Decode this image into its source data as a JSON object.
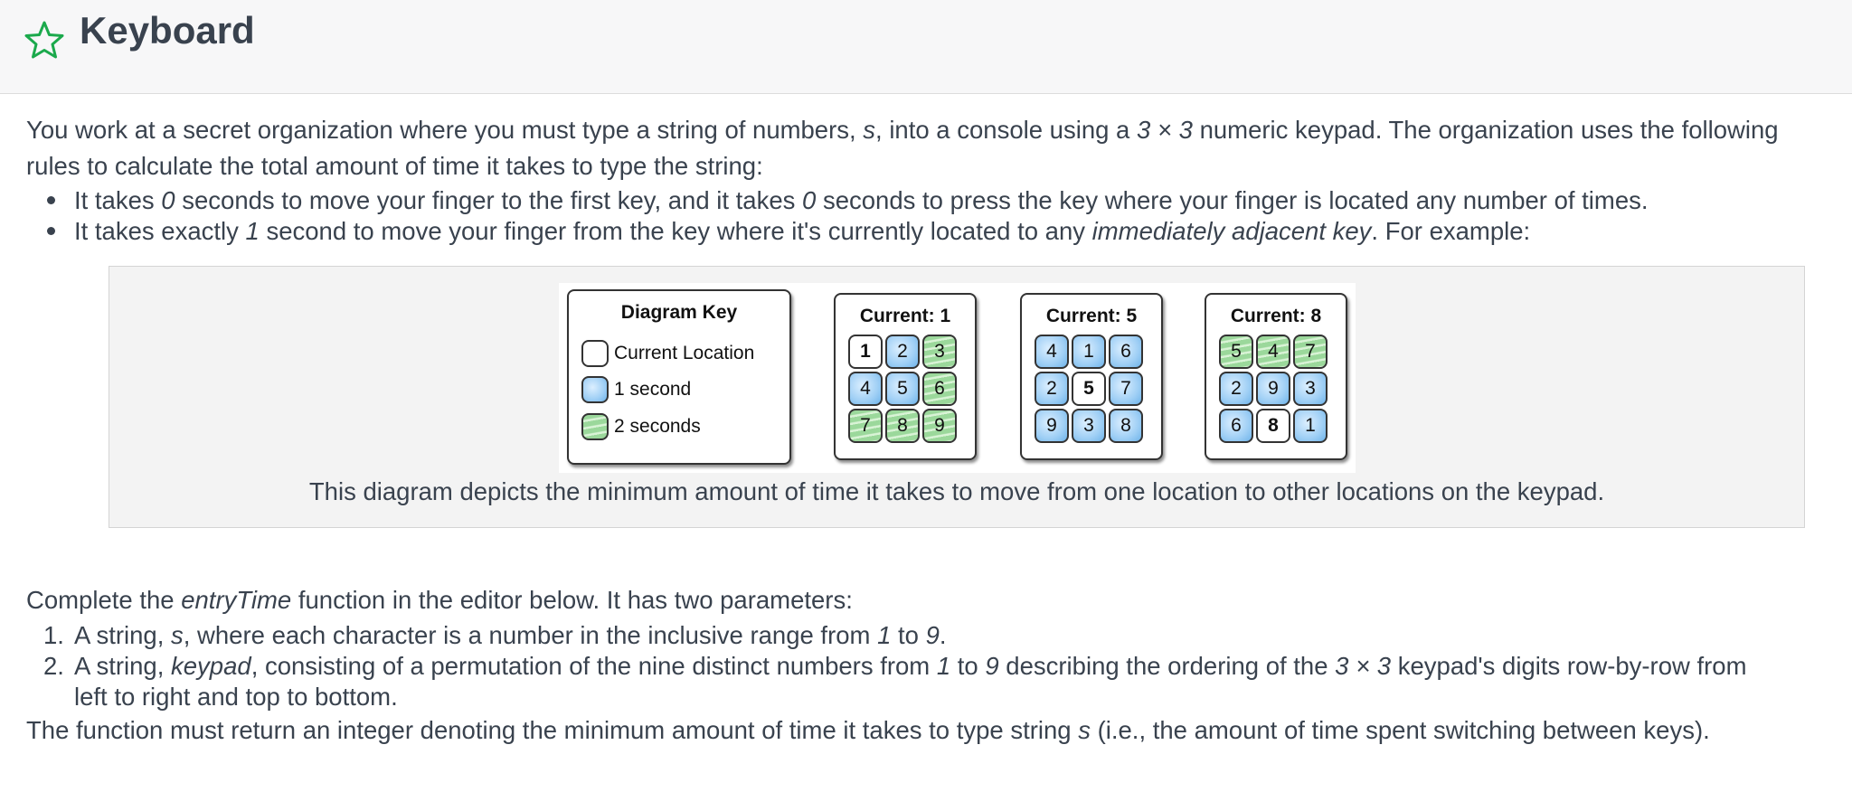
{
  "header": {
    "title": "Keyboard",
    "star_icon": "star-outline-icon",
    "accent": "#1ba94c"
  },
  "intro": {
    "p1_a": "You work at a secret organization where you must type a string of numbers, ",
    "p1_s": "s",
    "p1_b": ", into a console using a ",
    "p1_dim": "3 × 3",
    "p1_c": " numeric keypad. The organization uses the following",
    "p2": "rules to calculate the total amount of time it takes to type the string:"
  },
  "bullets": {
    "b1_a": "It takes ",
    "b1_zero1": "0",
    "b1_b": " seconds to move your finger to the first key, and it takes ",
    "b1_zero2": "0",
    "b1_c": " seconds to press the key where your finger is located any number of times.",
    "b2_a": "It takes exactly ",
    "b2_one": "1",
    "b2_b": " second to move your finger from the key where it's currently located to any ",
    "b2_adj": "immediately adjacent key",
    "b2_c": ". For example:"
  },
  "diagram": {
    "key_title": "Diagram Key",
    "key_items": [
      "Current Location",
      "1 second",
      "2 seconds"
    ],
    "panels": [
      {
        "title": "Current: 1",
        "cells": [
          "1",
          "2",
          "3",
          "4",
          "5",
          "6",
          "7",
          "8",
          "9"
        ],
        "types": [
          "c",
          "b",
          "g",
          "b",
          "b",
          "g",
          "g",
          "g",
          "g"
        ]
      },
      {
        "title": "Current: 5",
        "cells": [
          "4",
          "1",
          "6",
          "2",
          "5",
          "7",
          "9",
          "3",
          "8"
        ],
        "types": [
          "b",
          "b",
          "b",
          "b",
          "c",
          "b",
          "b",
          "b",
          "b"
        ]
      },
      {
        "title": "Current: 8",
        "cells": [
          "5",
          "4",
          "7",
          "2",
          "9",
          "3",
          "6",
          "8",
          "1"
        ],
        "types": [
          "g",
          "g",
          "g",
          "b",
          "b",
          "b",
          "b",
          "c",
          "b"
        ]
      }
    ],
    "caption": "This diagram depicts the minimum amount of time it takes to move from one location to other locations on the keypad."
  },
  "task": {
    "c1_a": "Complete the ",
    "c1_fn": "entryTime",
    "c1_b": " function in the editor below. It has two parameters:",
    "n1": "1.",
    "i1_a": "A string, ",
    "i1_s": "s",
    "i1_b": ", where each character is a number in the inclusive range from ",
    "i1_one": "1",
    "i1_to": " to ",
    "i1_nine": "9",
    "i1_end": ".",
    "n2": "2.",
    "i2_a": "A string, ",
    "i2_kp": "keypad",
    "i2_b": ", consisting of a permutation of the nine distinct numbers from ",
    "i2_one": "1",
    "i2_to": " to ",
    "i2_nine": "9",
    "i2_c": " describing the ordering of the ",
    "i2_dim": "3 × 3",
    "i2_d": " keypad's digits row-by-row from",
    "i2_line2": "left to right and top to bottom.",
    "ret_a": "The function must return an integer denoting the minimum amount of time it takes to type string ",
    "ret_s": "s",
    "ret_b": " (i.e., the amount of time spent switching between keys)."
  }
}
